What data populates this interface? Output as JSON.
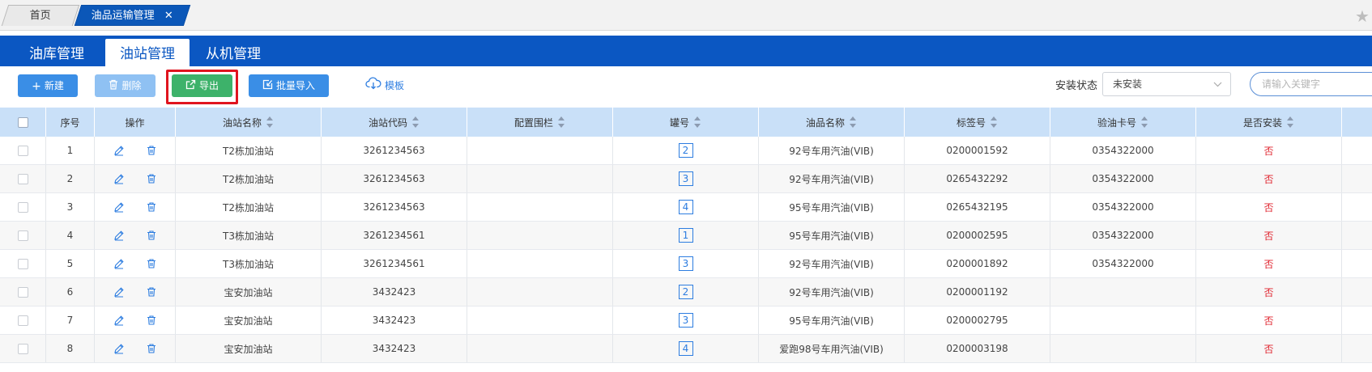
{
  "tabs": {
    "home": "首页",
    "active": "油品运输管理",
    "close": "✕"
  },
  "modules": [
    "油库管理",
    "油站管理",
    "从机管理"
  ],
  "toolbar": {
    "new": "新建",
    "delete": "删除",
    "export": "导出",
    "import": "批量导入",
    "template": "模板",
    "status_label": "安装状态",
    "status_value": "未安装",
    "search_placeholder": "请输入关键字"
  },
  "table": {
    "headers": {
      "seq": "序号",
      "op": "操作",
      "station_name": "油站名称",
      "station_code": "油站代码",
      "fence": "配置围栏",
      "tank": "罐号",
      "product": "油品名称",
      "tag": "标签号",
      "card": "验油卡号",
      "installed": "是否安装"
    },
    "rows": [
      {
        "seq": "1",
        "name": "T2栋加油站",
        "code": "3261234563",
        "fence": "",
        "tank": "2",
        "product": "92号车用汽油(VIB)",
        "tag": "0200001592",
        "card": "0354322000",
        "installed": "否"
      },
      {
        "seq": "2",
        "name": "T2栋加油站",
        "code": "3261234563",
        "fence": "",
        "tank": "3",
        "product": "92号车用汽油(VIB)",
        "tag": "0265432292",
        "card": "0354322000",
        "installed": "否"
      },
      {
        "seq": "3",
        "name": "T2栋加油站",
        "code": "3261234563",
        "fence": "",
        "tank": "4",
        "product": "95号车用汽油(VIB)",
        "tag": "0265432195",
        "card": "0354322000",
        "installed": "否"
      },
      {
        "seq": "4",
        "name": "T3栋加油站",
        "code": "3261234561",
        "fence": "",
        "tank": "1",
        "product": "95号车用汽油(VIB)",
        "tag": "0200002595",
        "card": "0354322000",
        "installed": "否"
      },
      {
        "seq": "5",
        "name": "T3栋加油站",
        "code": "3261234561",
        "fence": "",
        "tank": "3",
        "product": "92号车用汽油(VIB)",
        "tag": "0200001892",
        "card": "0354322000",
        "installed": "否"
      },
      {
        "seq": "6",
        "name": "宝安加油站",
        "code": "3432423",
        "fence": "",
        "tank": "2",
        "product": "92号车用汽油(VIB)",
        "tag": "0200001192",
        "card": "",
        "installed": "否"
      },
      {
        "seq": "7",
        "name": "宝安加油站",
        "code": "3432423",
        "fence": "",
        "tank": "3",
        "product": "95号车用汽油(VIB)",
        "tag": "0200002795",
        "card": "",
        "installed": "否"
      },
      {
        "seq": "8",
        "name": "宝安加油站",
        "code": "3432423",
        "fence": "",
        "tank": "4",
        "product": "爱跑98号车用汽油(VIB)",
        "tag": "0200003198",
        "card": "",
        "installed": "否"
      }
    ]
  },
  "icons": {
    "edit": "edit-icon",
    "trash": "trash-icon",
    "star": "star-icon"
  },
  "colors": {
    "primary": "#0b57c2",
    "export": "#3db26a",
    "danger": "#e0252f",
    "highlight": "#e0141e"
  }
}
